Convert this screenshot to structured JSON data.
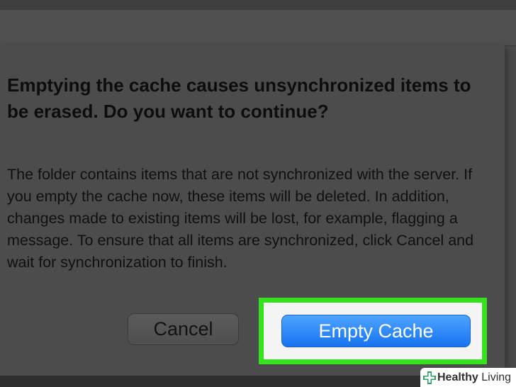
{
  "dialog": {
    "title": "Emptying the cache causes unsynchronized items to be erased. Do you want to continue?",
    "body": "The folder contains items that are not synchronized with the server. If you empty the cache now, these items will be deleted. In addition, changes made to existing items will be lost, for example, flagging a message. To ensure that all items are synchronized, click Cancel and wait for synchronization to finish.",
    "cancel_label": "Cancel",
    "confirm_label": "Empty Cache"
  },
  "highlight": {
    "color": "#36e11e"
  },
  "watermark": {
    "brand_bold": "Healthy",
    "brand_regular": " Living",
    "icon": "medical-cross-icon",
    "icon_color": "#2e9e63"
  },
  "colors": {
    "confirm_button": "#1573f0",
    "dialog_background": "#4c4c4c"
  }
}
